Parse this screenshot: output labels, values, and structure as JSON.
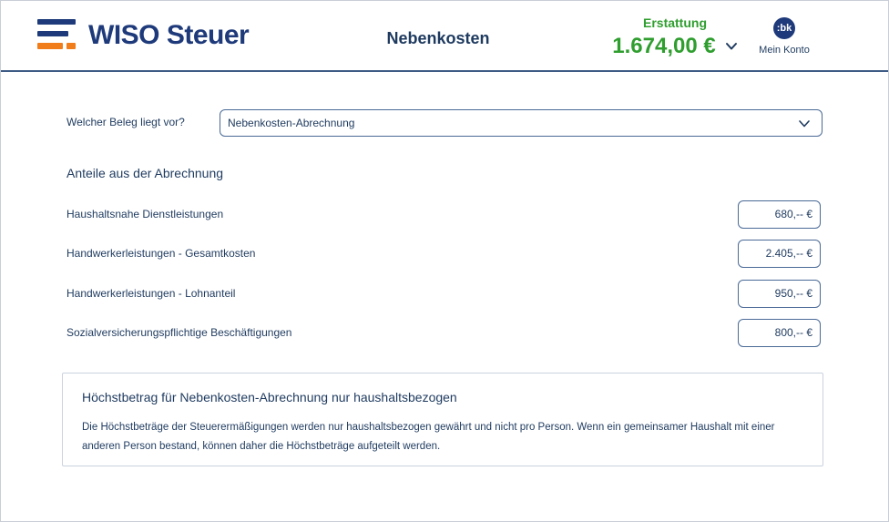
{
  "header": {
    "logo_text": "WISO Steuer",
    "page_title": "Nebenkosten",
    "refund_label": "Erstattung",
    "refund_amount": "1.674,00 €",
    "account_initials": ":bk",
    "account_label": "Mein Konto"
  },
  "form": {
    "beleg_label": "Welcher Beleg liegt vor?",
    "beleg_value": "Nebenkosten-Abrechnung",
    "section_heading": "Anteile aus der Abrechnung",
    "rows": [
      {
        "label": "Haushaltsnahe Dienstleistungen",
        "value": "680,-- €"
      },
      {
        "label": "Handwerkerleistungen - Gesamtkosten",
        "value": "2.405,-- €"
      },
      {
        "label": "Handwerkerleistungen - Lohnanteil",
        "value": "950,-- €"
      },
      {
        "label": "Sozialversicherungspflichtige Beschäftigungen",
        "value": "800,-- €"
      }
    ]
  },
  "info": {
    "title": "Höchstbetrag für Nebenkosten-Abrechnung nur haushaltsbezogen",
    "text": "Die Höchstbeträge der Steuerermäßigungen werden nur haushaltsbezogen gewährt und nicht pro Person. Wenn ein gemeinsamer Haushalt mit einer anderen Person bestand, können daher die Höchstbeträge aufgeteilt werden."
  },
  "colors": {
    "brand_blue": "#1e3a7a",
    "brand_orange": "#f07c1a",
    "refund_green": "#2f9e2f",
    "text_navy": "#1e3a5f"
  },
  "icons": {
    "logo": "wiso-logo-icon",
    "refund_toggle": "chevron-down-icon",
    "select_toggle": "chevron-down-icon",
    "account": "avatar"
  }
}
